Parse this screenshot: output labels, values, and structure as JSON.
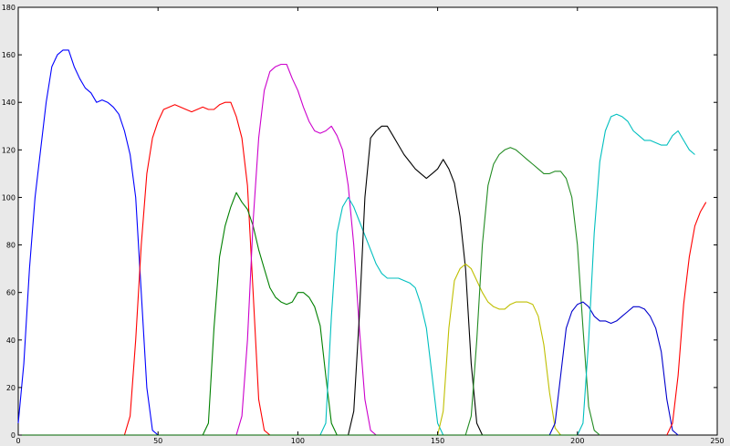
{
  "chart_data": {
    "type": "line",
    "title": "",
    "xlabel": "",
    "ylabel": "",
    "xlim": [
      0,
      250
    ],
    "ylim": [
      0,
      180
    ],
    "xticks": [
      0,
      50,
      100,
      150,
      200,
      250
    ],
    "yticks": [
      0,
      20,
      40,
      60,
      80,
      100,
      120,
      140,
      160,
      180
    ],
    "grid": false,
    "legend": "none",
    "series": [
      {
        "color": "#0000ff",
        "points": [
          [
            0,
            5
          ],
          [
            2,
            30
          ],
          [
            4,
            70
          ],
          [
            6,
            100
          ],
          [
            8,
            120
          ],
          [
            10,
            140
          ],
          [
            12,
            155
          ],
          [
            14,
            160
          ],
          [
            16,
            162
          ],
          [
            18,
            162
          ],
          [
            20,
            155
          ],
          [
            22,
            150
          ],
          [
            24,
            146
          ],
          [
            26,
            144
          ],
          [
            28,
            140
          ],
          [
            30,
            141
          ],
          [
            32,
            140
          ],
          [
            34,
            138
          ],
          [
            36,
            135
          ],
          [
            38,
            128
          ],
          [
            40,
            118
          ],
          [
            42,
            100
          ],
          [
            44,
            60
          ],
          [
            46,
            20
          ],
          [
            48,
            2
          ],
          [
            50,
            0
          ]
        ]
      },
      {
        "color": "#ff0000",
        "points": [
          [
            38,
            0
          ],
          [
            40,
            8
          ],
          [
            42,
            40
          ],
          [
            44,
            80
          ],
          [
            46,
            110
          ],
          [
            48,
            125
          ],
          [
            50,
            132
          ],
          [
            52,
            137
          ],
          [
            54,
            138
          ],
          [
            56,
            139
          ],
          [
            58,
            138
          ],
          [
            60,
            137
          ],
          [
            62,
            136
          ],
          [
            64,
            137
          ],
          [
            66,
            138
          ],
          [
            68,
            137
          ],
          [
            70,
            137
          ],
          [
            72,
            139
          ],
          [
            74,
            140
          ],
          [
            76,
            140
          ],
          [
            78,
            134
          ],
          [
            80,
            125
          ],
          [
            82,
            105
          ],
          [
            84,
            60
          ],
          [
            86,
            15
          ],
          [
            88,
            2
          ],
          [
            90,
            0
          ]
        ]
      },
      {
        "color": "#008000",
        "points": [
          [
            66,
            0
          ],
          [
            68,
            5
          ],
          [
            70,
            45
          ],
          [
            72,
            75
          ],
          [
            74,
            88
          ],
          [
            76,
            96
          ],
          [
            78,
            102
          ],
          [
            80,
            98
          ],
          [
            82,
            95
          ],
          [
            84,
            88
          ],
          [
            86,
            78
          ],
          [
            88,
            70
          ],
          [
            90,
            62
          ],
          [
            92,
            58
          ],
          [
            94,
            56
          ],
          [
            96,
            55
          ],
          [
            98,
            56
          ],
          [
            100,
            60
          ],
          [
            102,
            60
          ],
          [
            104,
            58
          ],
          [
            106,
            54
          ],
          [
            108,
            46
          ],
          [
            110,
            25
          ],
          [
            112,
            5
          ],
          [
            114,
            0
          ]
        ]
      },
      {
        "color": "#cc00cc",
        "points": [
          [
            78,
            0
          ],
          [
            80,
            8
          ],
          [
            82,
            40
          ],
          [
            84,
            90
          ],
          [
            86,
            125
          ],
          [
            88,
            145
          ],
          [
            90,
            153
          ],
          [
            92,
            155
          ],
          [
            94,
            156
          ],
          [
            96,
            156
          ],
          [
            98,
            150
          ],
          [
            100,
            145
          ],
          [
            102,
            138
          ],
          [
            104,
            132
          ],
          [
            106,
            128
          ],
          [
            108,
            127
          ],
          [
            110,
            128
          ],
          [
            112,
            130
          ],
          [
            114,
            126
          ],
          [
            116,
            120
          ],
          [
            118,
            105
          ],
          [
            120,
            80
          ],
          [
            122,
            45
          ],
          [
            124,
            15
          ],
          [
            126,
            2
          ],
          [
            128,
            0
          ]
        ]
      },
      {
        "color": "#00bfbf",
        "points": [
          [
            108,
            0
          ],
          [
            110,
            5
          ],
          [
            112,
            50
          ],
          [
            114,
            85
          ],
          [
            116,
            96
          ],
          [
            118,
            100
          ],
          [
            120,
            96
          ],
          [
            122,
            90
          ],
          [
            124,
            84
          ],
          [
            126,
            78
          ],
          [
            128,
            72
          ],
          [
            130,
            68
          ],
          [
            132,
            66
          ],
          [
            134,
            66
          ],
          [
            136,
            66
          ],
          [
            138,
            65
          ],
          [
            140,
            64
          ],
          [
            142,
            62
          ],
          [
            144,
            55
          ],
          [
            146,
            45
          ],
          [
            148,
            25
          ],
          [
            150,
            5
          ],
          [
            152,
            0
          ]
        ]
      },
      {
        "color": "#000000",
        "points": [
          [
            118,
            0
          ],
          [
            120,
            10
          ],
          [
            122,
            50
          ],
          [
            124,
            100
          ],
          [
            126,
            125
          ],
          [
            128,
            128
          ],
          [
            130,
            130
          ],
          [
            132,
            130
          ],
          [
            134,
            126
          ],
          [
            136,
            122
          ],
          [
            138,
            118
          ],
          [
            140,
            115
          ],
          [
            142,
            112
          ],
          [
            144,
            110
          ],
          [
            146,
            108
          ],
          [
            148,
            110
          ],
          [
            150,
            112
          ],
          [
            152,
            116
          ],
          [
            154,
            112
          ],
          [
            156,
            106
          ],
          [
            158,
            92
          ],
          [
            160,
            70
          ],
          [
            162,
            30
          ],
          [
            164,
            5
          ],
          [
            166,
            0
          ]
        ]
      },
      {
        "color": "#bfbf00",
        "points": [
          [
            150,
            0
          ],
          [
            152,
            10
          ],
          [
            154,
            45
          ],
          [
            156,
            65
          ],
          [
            158,
            70
          ],
          [
            160,
            72
          ],
          [
            162,
            70
          ],
          [
            164,
            65
          ],
          [
            166,
            60
          ],
          [
            168,
            56
          ],
          [
            170,
            54
          ],
          [
            172,
            53
          ],
          [
            174,
            53
          ],
          [
            176,
            55
          ],
          [
            178,
            56
          ],
          [
            180,
            56
          ],
          [
            182,
            56
          ],
          [
            184,
            55
          ],
          [
            186,
            50
          ],
          [
            188,
            38
          ],
          [
            190,
            18
          ],
          [
            192,
            3
          ],
          [
            194,
            0
          ]
        ]
      },
      {
        "color": "#228b22",
        "points": [
          [
            160,
            0
          ],
          [
            162,
            8
          ],
          [
            164,
            40
          ],
          [
            166,
            80
          ],
          [
            168,
            105
          ],
          [
            170,
            114
          ],
          [
            172,
            118
          ],
          [
            174,
            120
          ],
          [
            176,
            121
          ],
          [
            178,
            120
          ],
          [
            180,
            118
          ],
          [
            182,
            116
          ],
          [
            184,
            114
          ],
          [
            186,
            112
          ],
          [
            188,
            110
          ],
          [
            190,
            110
          ],
          [
            192,
            111
          ],
          [
            194,
            111
          ],
          [
            196,
            108
          ],
          [
            198,
            100
          ],
          [
            200,
            80
          ],
          [
            202,
            45
          ],
          [
            204,
            12
          ],
          [
            206,
            2
          ],
          [
            208,
            0
          ]
        ]
      },
      {
        "color": "#0000cc",
        "points": [
          [
            190,
            0
          ],
          [
            192,
            5
          ],
          [
            194,
            25
          ],
          [
            196,
            45
          ],
          [
            198,
            52
          ],
          [
            200,
            55
          ],
          [
            202,
            56
          ],
          [
            204,
            54
          ],
          [
            206,
            50
          ],
          [
            208,
            48
          ],
          [
            210,
            48
          ],
          [
            212,
            47
          ],
          [
            214,
            48
          ],
          [
            216,
            50
          ],
          [
            218,
            52
          ],
          [
            220,
            54
          ],
          [
            222,
            54
          ],
          [
            224,
            53
          ],
          [
            226,
            50
          ],
          [
            228,
            45
          ],
          [
            230,
            35
          ],
          [
            232,
            15
          ],
          [
            234,
            2
          ],
          [
            236,
            0
          ]
        ]
      },
      {
        "color": "#00bfbf",
        "points": [
          [
            200,
            0
          ],
          [
            202,
            5
          ],
          [
            204,
            40
          ],
          [
            206,
            85
          ],
          [
            208,
            115
          ],
          [
            210,
            128
          ],
          [
            212,
            134
          ],
          [
            214,
            135
          ],
          [
            216,
            134
          ],
          [
            218,
            132
          ],
          [
            220,
            128
          ],
          [
            222,
            126
          ],
          [
            224,
            124
          ],
          [
            226,
            124
          ],
          [
            228,
            123
          ],
          [
            230,
            122
          ],
          [
            232,
            122
          ],
          [
            234,
            126
          ],
          [
            236,
            128
          ],
          [
            238,
            124
          ],
          [
            240,
            120
          ],
          [
            242,
            118
          ]
        ]
      },
      {
        "color": "#ff0000",
        "points": [
          [
            232,
            0
          ],
          [
            234,
            5
          ],
          [
            236,
            25
          ],
          [
            238,
            55
          ],
          [
            240,
            75
          ],
          [
            242,
            88
          ],
          [
            244,
            94
          ],
          [
            246,
            98
          ]
        ]
      },
      {
        "color": "#006400",
        "points": [
          [
            0,
            0
          ],
          [
            200,
            0
          ]
        ]
      }
    ]
  }
}
